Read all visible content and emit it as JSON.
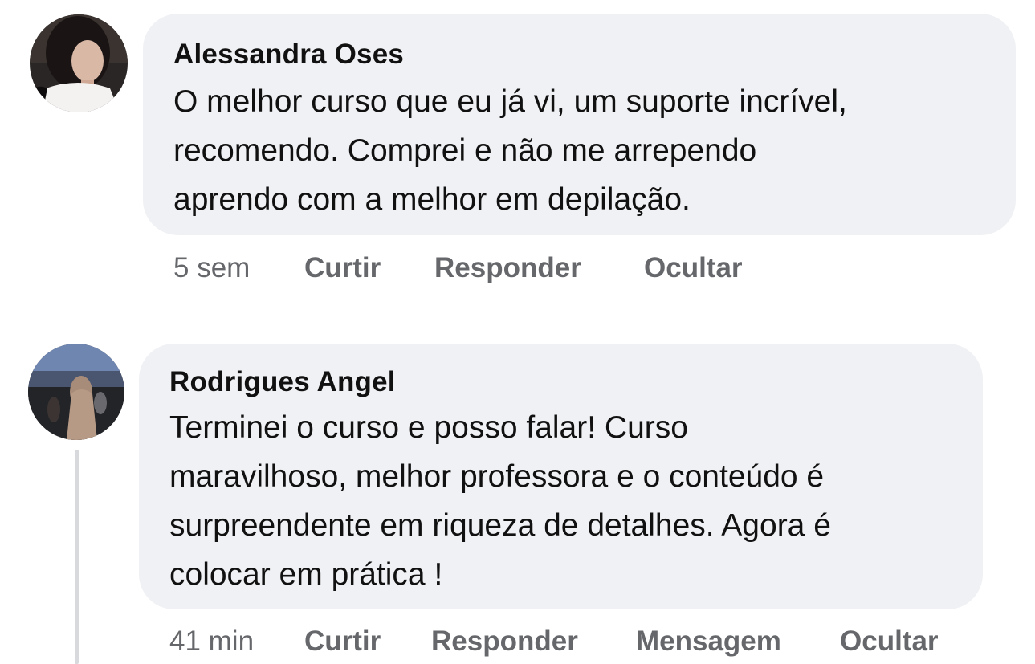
{
  "comments": [
    {
      "author": "Alessandra Oses",
      "lines": [
        "O melhor curso que eu já vi, um suporte incrível,",
        "recomendo. Comprei e não me arrependo",
        "aprendo com a melhor em depilação."
      ],
      "time": "5 sem",
      "actions": {
        "like": "Curtir",
        "reply": "Responder",
        "hide": "Ocultar"
      }
    },
    {
      "author": "Rodrigues Angel",
      "lines": [
        "Terminei o curso e posso falar!  Curso",
        "maravilhoso, melhor professora e o conteúdo é",
        "surpreendente em riqueza de detalhes. Agora é",
        "colocar em prática !"
      ],
      "time": "41 min",
      "actions": {
        "like": "Curtir",
        "reply": "Responder",
        "message": "Mensagem",
        "hide": "Ocultar"
      }
    }
  ],
  "colors": {
    "bubble": "#f0f1f4",
    "text": "#111111",
    "secondary": "#65676b"
  }
}
